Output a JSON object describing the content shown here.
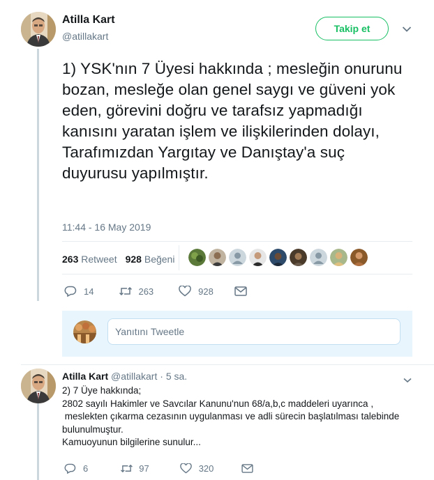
{
  "main_tweet": {
    "author_name": "Atilla Kart",
    "author_handle": "@atillakart",
    "follow_label": "Takip et",
    "text": "1) YSK'nın 7 Üyesi hakkında ; mesleğin onurunu bozan, mesleğe olan genel saygı ve güveni yok eden, görevini doğru ve tarafsız yapmadığı kanısını yaratan işlem ve ilişkilerinden dolayı, Tarafımızdan Yargıtay ve Danıştay'a suç duyurusu yapılmıştır.",
    "timestamp": "11:44 - 16 May 2019",
    "retweet_count": "263",
    "retweet_label": "Retweet",
    "like_count": "928",
    "like_label": "Beğeni",
    "actions": {
      "reply_count": "14",
      "retweet_count": "263",
      "like_count": "928"
    }
  },
  "reply_box": {
    "placeholder": "Yanıtını Tweetle"
  },
  "second_tweet": {
    "author_name": "Atilla Kart",
    "author_handle": "@atillakart",
    "separator": "·",
    "time": "5 sa.",
    "lines": [
      "2) 7 Üye hakkında;",
      "2802 sayılı Hakimler ve Savcılar Kanunu'nun 68/a,b,c maddeleri uyarınca ,",
      " meslekten çıkarma cezasının uygulanması ve adli sürecin başlatılması talebinde bulunulmuştur.",
      "Kamuoyunun bilgilerine sunulur..."
    ],
    "actions": {
      "reply_count": "6",
      "retweet_count": "97",
      "like_count": "320"
    }
  },
  "colors": {
    "accent_green": "#17bf63",
    "muted_gray": "#657786",
    "reply_box_bg": "#e8f5fd"
  }
}
